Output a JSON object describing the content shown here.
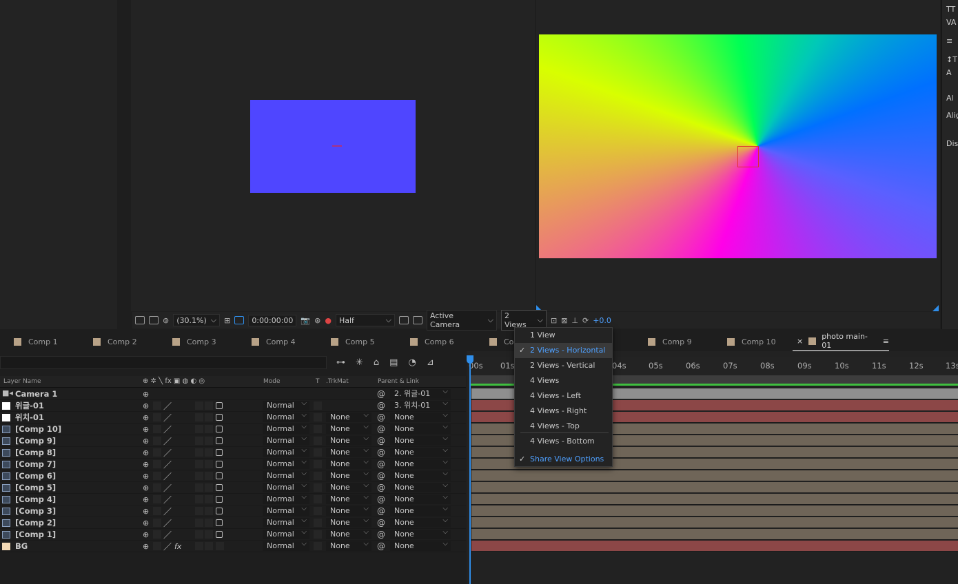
{
  "viewer_toolbar": {
    "zoom": "(30.1%)",
    "timecode": "0:00:00:00",
    "resolution": "Half",
    "camera": "Active Camera",
    "views": "2 Views",
    "exposure": "+0.0"
  },
  "comp_tabs": [
    {
      "label": "Comp 1"
    },
    {
      "label": "Comp 2"
    },
    {
      "label": "Comp 3"
    },
    {
      "label": "Comp 4"
    },
    {
      "label": "Comp 5"
    },
    {
      "label": "Comp 6"
    },
    {
      "label": "Co"
    },
    {
      "label": "Comp 9"
    },
    {
      "label": "Comp 10"
    },
    {
      "label": "photo main-01",
      "active": true
    }
  ],
  "right_panel_glyphs": [
    "TT",
    "VA",
    "≡",
    "↕T",
    "A",
    "Al",
    "Alig",
    "Dis"
  ],
  "timeline_header": {
    "layer_name": "Layer Name",
    "mode": "Mode",
    "t": "T",
    "trkmat": ".TrkMat",
    "parent": "Parent & Link"
  },
  "layers": [
    {
      "name": "Camera 1",
      "mode": "",
      "trkmat": "",
      "parent": "2. 위글-01",
      "bar_color": "#8f8f8f"
    },
    {
      "name": "위글-01",
      "mode": "Normal",
      "trkmat": "",
      "parent": "3. 위치-01",
      "bar_color": "#8c4747"
    },
    {
      "name": "위치-01",
      "mode": "Normal",
      "trkmat": "None",
      "parent": "None",
      "bar_color": "#8c4747"
    },
    {
      "name": "[Comp 10]",
      "mode": "Normal",
      "trkmat": "None",
      "parent": "None",
      "bar_color": "#6f6558"
    },
    {
      "name": "[Comp 9]",
      "mode": "Normal",
      "trkmat": "None",
      "parent": "None",
      "bar_color": "#6f6558"
    },
    {
      "name": "[Comp 8]",
      "mode": "Normal",
      "trkmat": "None",
      "parent": "None",
      "bar_color": "#6f6558"
    },
    {
      "name": "[Comp 7]",
      "mode": "Normal",
      "trkmat": "None",
      "parent": "None",
      "bar_color": "#6f6558"
    },
    {
      "name": "[Comp 6]",
      "mode": "Normal",
      "trkmat": "None",
      "parent": "None",
      "bar_color": "#6f6558"
    },
    {
      "name": "[Comp 5]",
      "mode": "Normal",
      "trkmat": "None",
      "parent": "None",
      "bar_color": "#6f6558"
    },
    {
      "name": "[Comp 4]",
      "mode": "Normal",
      "trkmat": "None",
      "parent": "None",
      "bar_color": "#6f6558"
    },
    {
      "name": "[Comp 3]",
      "mode": "Normal",
      "trkmat": "None",
      "parent": "None",
      "bar_color": "#6f6558"
    },
    {
      "name": "[Comp 2]",
      "mode": "Normal",
      "trkmat": "None",
      "parent": "None",
      "bar_color": "#6f6558"
    },
    {
      "name": "[Comp 1]",
      "mode": "Normal",
      "trkmat": "None",
      "parent": "None",
      "bar_color": "#6f6558"
    },
    {
      "name": "BG",
      "mode": "Normal",
      "trkmat": "None",
      "parent": "None",
      "bar_color": "#8c4747"
    }
  ],
  "ruler_ticks": [
    "00s",
    "01s",
    "04s",
    "05s",
    "06s",
    "07s",
    "08s",
    "09s",
    "10s",
    "11s",
    "12s",
    "13s"
  ],
  "views_menu": {
    "items": [
      {
        "label": "1 View",
        "checked": false
      },
      {
        "label": "2 Views - Horizontal",
        "checked": true
      },
      {
        "label": "2 Views - Vertical",
        "checked": false
      },
      {
        "label": "4 Views",
        "checked": false
      },
      {
        "label": "4 Views - Left",
        "checked": false
      },
      {
        "label": "4 Views - Right",
        "checked": false
      },
      {
        "label": "4 Views - Top",
        "checked": false
      },
      {
        "label": "4 Views - Bottom",
        "checked": false
      }
    ],
    "share": "Share View Options"
  },
  "colors": {
    "accent": "#2f8eea",
    "left_comp": "#4f46ff",
    "label_swatch": "#b8a287"
  }
}
